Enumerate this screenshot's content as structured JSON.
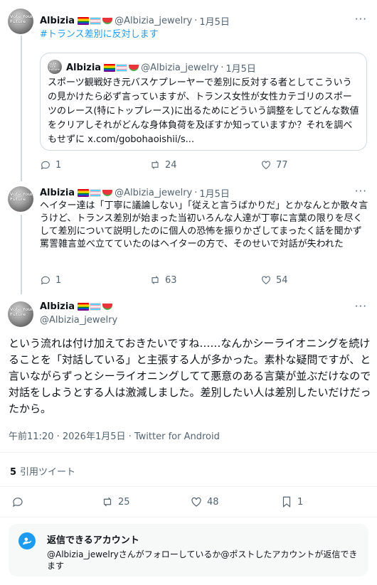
{
  "tweet1": {
    "avatar_text": "Vote Your Future",
    "name": "Albizia",
    "handle": "@Albizia_jewelry",
    "dot": "·",
    "time": "1月5日",
    "text": "#トランス差別に反対します",
    "quote": {
      "name": "Albizia",
      "handle": "@Albizia_jewelry",
      "dot": "·",
      "time": "1月5日",
      "text": "スポーツ観戦好き元バスケプレーヤーで差別に反対する者としてこういうの見かけたら必ず言っていますが、トランス女性が女性カテゴリのスポーツのレース(特にトップレース)に出るためにどういう調整をしてどんな数値をクリアしそれがどんな身体負荷を及ぼすか知っていますか？それを調べもせずに x.com/gobohaoishii/s..."
    },
    "actions": {
      "replies": "1",
      "reposts": "24",
      "likes": "77"
    }
  },
  "tweet2": {
    "avatar_text": "Vote Your Future",
    "name": "Albizia",
    "handle": "@Albizia_jewelry",
    "dot": "·",
    "time": "1月5日",
    "text": "ヘイター達は「丁寧に議論しない」「従えと言うばかりだ」とかなんとか散々言うけど、トランス差別が始まった当初いろんな人達が丁寧に言葉の限りを尽くして差別について説明したのに個人の恐怖を振りかざしてまったく話を聞かず罵詈雑言並べ立てていたのはヘイターの方で、そのせいで対話が失われた",
    "actions": {
      "replies": "1",
      "reposts": "63",
      "likes": "54"
    }
  },
  "main_tweet": {
    "avatar_text": "Vote Your Future",
    "name": "Albizia",
    "handle": "@Albizia_jewelry",
    "text": "という流れは付け加えておきたいですね……なんかシーライオニングを続けることを「対話している」と主張する人が多かった。素朴な疑問ですが、と言いながらずっとシーライオニングしてて悪意のある言葉が並ぶだけなので対話をしようとする人は激減しました。差別したい人は差別したいだけだったから。",
    "meta": "午前11:20 · 2026年1月5日 · Twitter for Android",
    "quote_count": "5",
    "quote_label": "引用ツイート",
    "actions": {
      "reposts": "25",
      "likes": "48",
      "bookmarks": "1"
    }
  },
  "reply_restriction": {
    "title": "返信できるアカウント",
    "description": "@Albizia_jewelryさんがフォローしているか@ポストしたアカウントが返信できます"
  },
  "more_icon": "···",
  "colors": {
    "accent": "#1d9bf0",
    "muted": "#536471",
    "border": "#cfd9de"
  }
}
